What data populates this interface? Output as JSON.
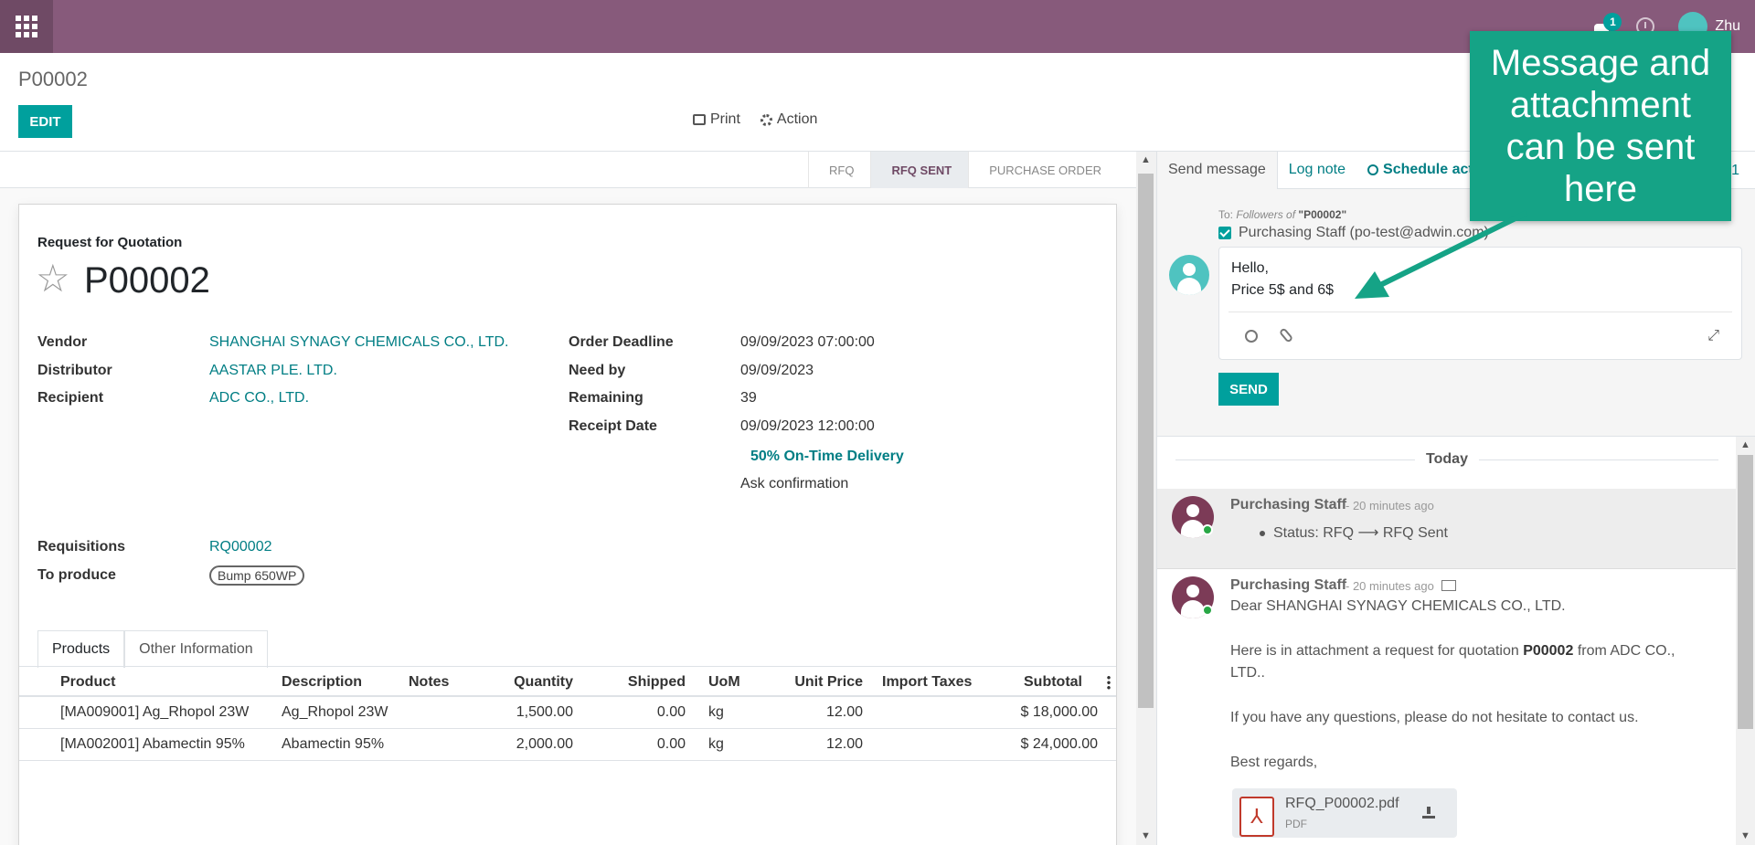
{
  "navbar": {
    "chat_count": "1",
    "user_name": "Zhu"
  },
  "control_panel": {
    "breadcrumb": "P00002",
    "edit_label": "EDIT",
    "print_label": "Print",
    "action_label": "Action"
  },
  "statusbar": {
    "stages": [
      "RFQ",
      "RFQ SENT",
      "PURCHASE ORDER"
    ],
    "active_stage": "RFQ SENT"
  },
  "form": {
    "doc_type": "Request for Quotation",
    "name": "P00002",
    "left_fields": [
      {
        "label": "Vendor",
        "value": "SHANGHAI SYNAGY CHEMICALS CO., LTD."
      },
      {
        "label": "Distributor",
        "value": "AASTAR PLE. LTD."
      },
      {
        "label": "Recipient",
        "value": "ADC CO., LTD."
      }
    ],
    "right_fields": [
      {
        "label": "Order Deadline",
        "value": "09/09/2023 07:00:00"
      },
      {
        "label": "Need by",
        "value": "09/09/2023"
      },
      {
        "label": "Remaining",
        "value": "39"
      },
      {
        "label": "Receipt Date",
        "value": "09/09/2023 12:00:00"
      }
    ],
    "on_time_delivery": "50% On-Time Delivery",
    "ask_confirmation": "Ask confirmation",
    "requisitions_label": "Requisitions",
    "requisitions_value": "RQ00002",
    "to_produce_label": "To produce",
    "to_produce_tag": "Bump 650WP"
  },
  "notebook": {
    "tabs": [
      "Products",
      "Other Information"
    ]
  },
  "table": {
    "headers": [
      "Product",
      "Description",
      "Notes",
      "Quantity",
      "Shipped",
      "UoM",
      "Unit Price",
      "Import Taxes",
      "Subtotal"
    ],
    "rows": [
      {
        "product": "[MA009001] Ag_Rhopol 23W",
        "description": "Ag_Rhopol 23W",
        "notes": "",
        "quantity": "1,500.00",
        "shipped": "0.00",
        "uom": "kg",
        "unit_price": "12.00",
        "taxes": "",
        "subtotal": "$ 18,000.00"
      },
      {
        "product": "[MA002001] Abamectin 95%",
        "description": "Abamectin 95%",
        "notes": "",
        "quantity": "2,000.00",
        "shipped": "0.00",
        "uom": "kg",
        "unit_price": "12.00",
        "taxes": "",
        "subtotal": "$ 24,000.00"
      }
    ]
  },
  "chatter": {
    "tabs": {
      "send_message": "Send message",
      "log_note": "Log note",
      "schedule": "Schedule act"
    },
    "followers_count": "1",
    "to_prefix": "To:",
    "to_followers": "Followers of",
    "to_record": "\"P00002\"",
    "recipient": "Purchasing Staff (po-test@adwin.com)",
    "message_lines": [
      "Hello,",
      "Price 5$ and 6$"
    ],
    "send_label": "SEND",
    "today_label": "Today",
    "messages": [
      {
        "author": "Purchasing Staff",
        "time": "- 20 minutes ago",
        "status_text": "Status: RFQ ⟶ RFQ Sent"
      },
      {
        "author": "Purchasing Staff",
        "time": "- 20 minutes ago",
        "lines": [
          "Dear SHANGHAI SYNAGY CHEMICALS CO., LTD.",
          "Here is in attachment a request for quotation",
          "P00002",
          "from ADC CO.,",
          "LTD..",
          "If you have any questions, please do not hesitate to contact us.",
          "Best regards,"
        ],
        "attachment_name": "RFQ_P00002.pdf",
        "attachment_type": "PDF"
      }
    ]
  },
  "annotation": {
    "callout_text": "Message and attachment can be sent here",
    "color": "#15a386"
  }
}
